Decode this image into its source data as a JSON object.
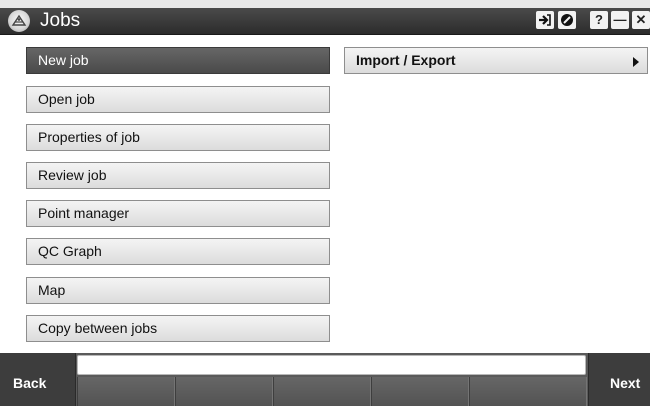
{
  "window": {
    "title": "Jobs",
    "app_icon": "trimble-access-icon",
    "controls": {
      "login_icon": "login-arrow-icon",
      "block_icon": "no-entry-icon",
      "help_label": "?",
      "minimize_label": "—",
      "close_label": "✕"
    }
  },
  "menu": {
    "left_items": [
      {
        "label": "New job",
        "selected": true
      },
      {
        "label": "Open job"
      },
      {
        "label": "Properties of job"
      },
      {
        "label": "Review job"
      },
      {
        "label": "Point manager"
      },
      {
        "label": "QC Graph"
      },
      {
        "label": "Map"
      },
      {
        "label": "Copy between jobs"
      }
    ],
    "right_items": [
      {
        "label": "Import / Export",
        "has_submenu": true
      }
    ]
  },
  "bottom_bar": {
    "back_label": "Back",
    "next_label": "Next",
    "status_text": "",
    "softkeys": [
      "",
      "",
      "",
      "",
      ""
    ]
  }
}
